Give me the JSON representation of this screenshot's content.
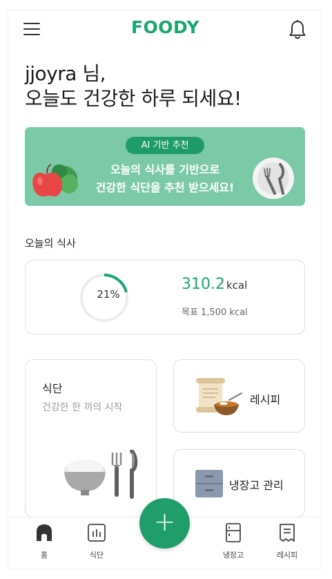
{
  "header": {
    "logo": "FOODY"
  },
  "greeting": {
    "line1": "jjoyra 님,",
    "line2": "오늘도 건강한 하루 되세요!"
  },
  "banner": {
    "pill": "AI 기반 추천",
    "line1": "오늘의 식사를 기반으로",
    "line2": "건강한 식단을 추천 받으세요!"
  },
  "today": {
    "section_title": "오늘의 식사",
    "progress": 21,
    "progress_label": "21%",
    "kcal_value": "310.2",
    "kcal_unit": "kcal",
    "goal": "목표 1,500 kcal"
  },
  "cards": {
    "diet_title": "식단",
    "diet_subtitle": "건강한 한 끼의 시작",
    "recipe_label": "레시피",
    "fridge_label": "냉장고 관리"
  },
  "nav": {
    "home": "홈",
    "diet": "식단",
    "fridge": "냉장고",
    "recipe": "레시피"
  },
  "colors": {
    "brand": "#1ca66f",
    "banner_bg": "#7cc9a8",
    "fab": "#1f9e6b"
  }
}
